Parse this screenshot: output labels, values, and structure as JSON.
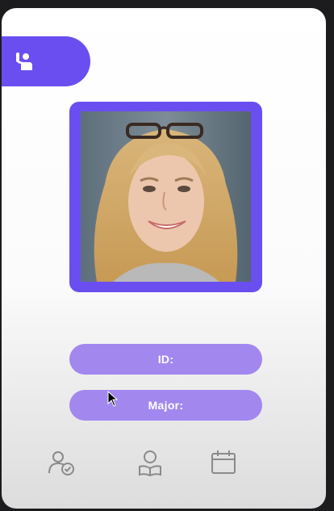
{
  "card": {
    "tab_icon": "raised-hand-person-icon",
    "photo_alt": "student-portrait",
    "id_label": "ID:",
    "major_label": "Major:"
  },
  "bottom_nav": [
    {
      "icon": "user-check-icon"
    },
    {
      "icon": "reader-person-icon"
    },
    {
      "icon": "calendar-icon"
    }
  ],
  "colors": {
    "accent": "#6a4ef0",
    "field": "#a287ef",
    "icon_gray": "#8a8a8a"
  }
}
